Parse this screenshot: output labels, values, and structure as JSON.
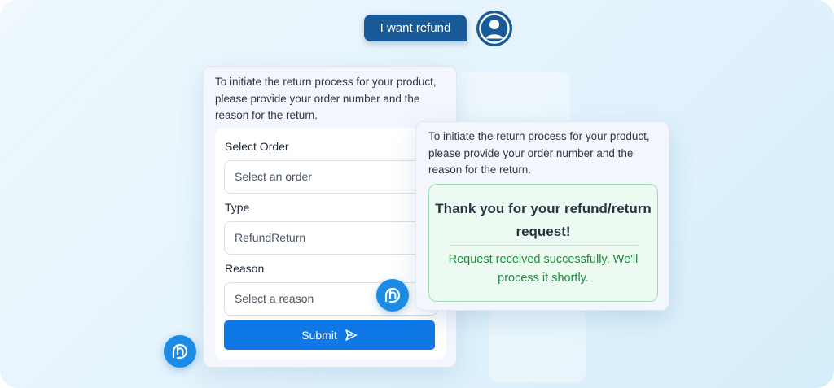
{
  "chat": {
    "user_message": "I want refund",
    "bot_message": "To initiate the return process for your product, please provide your order number and the reason for the return."
  },
  "form": {
    "order_label": "Select Order",
    "order_placeholder": "Select an order",
    "type_label": "Type",
    "type_value": "RefundReturn",
    "reason_label": "Reason",
    "reason_placeholder": "Select a reason",
    "submit_label": "Submit"
  },
  "confirmation": {
    "bot_message": "To initiate the return process for your product, please provide your order number and the reason for the return.",
    "title": "Thank you for your refund/return request!",
    "subtitle": "Request received successfully, We'll process it shortly."
  },
  "icons": {
    "user_avatar": "user-avatar-icon",
    "bot_avatar": "bot-logo-icon",
    "send": "send-arrow-icon"
  },
  "colors": {
    "user_bubble": "#195a98",
    "submit_button": "#0e78e6",
    "bot_icon": "#1b8be6",
    "success_text": "#1f8a43",
    "success_border": "#9fdcb4"
  }
}
